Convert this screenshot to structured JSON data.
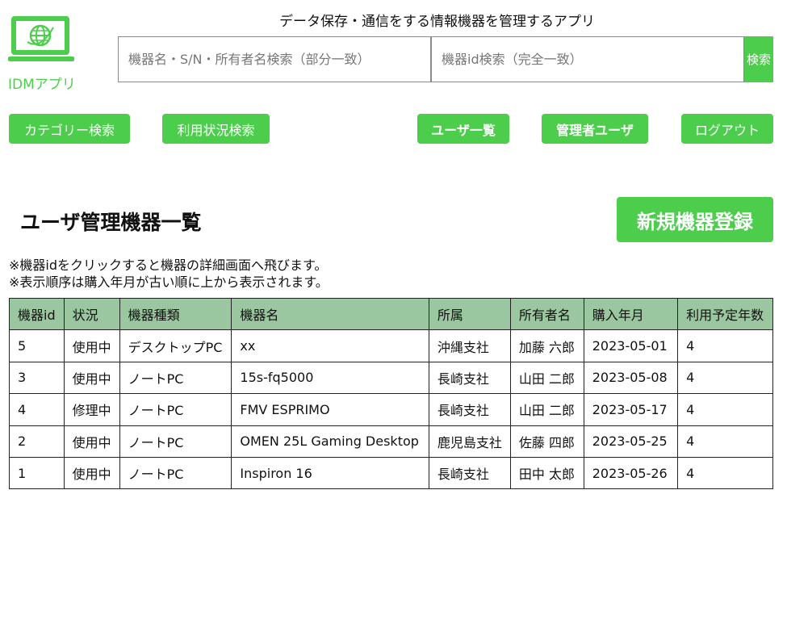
{
  "header": {
    "logo_text": "IDMアプリ",
    "subtitle": "データ保存・通信をする情報機器を管理するアプリ",
    "search": {
      "name_placeholder": "機器名・S/N・所有者名検索（部分一致）",
      "name_value": "",
      "id_placeholder": "機器id検索（完全一致）",
      "id_value": "",
      "button_label": "検索"
    },
    "colors": {
      "accent": "#4cce4c",
      "table_header": "#9ac79f"
    }
  },
  "nav": {
    "category_search": "カテゴリー検索",
    "usage_search": "利用状況検索",
    "user_list": "ユーザ一覧",
    "admin_user": "管理者ユーザ",
    "logout": "ログアウト"
  },
  "main": {
    "title": "ユーザ管理機器一覧",
    "register_button": "新規機器登録",
    "notes": [
      "※機器idをクリックすると機器の詳細画面へ飛びます。",
      "※表示順序は購入年月が古い順に上から表示されます。"
    ],
    "table": {
      "headers": [
        "機器id",
        "状況",
        "機器種類",
        "機器名",
        "所属",
        "所有者名",
        "購入年月",
        "利用予定年数"
      ],
      "rows": [
        [
          "5",
          "使用中",
          "デスクトップPC",
          "xx",
          "沖縄支社",
          "加藤 六郎",
          "2023-05-01",
          "4"
        ],
        [
          "3",
          "使用中",
          "ノートPC",
          "15s-fq5000",
          "長崎支社",
          "山田 二郎",
          "2023-05-08",
          "4"
        ],
        [
          "4",
          "修理中",
          "ノートPC",
          "FMV ESPRIMO",
          "長崎支社",
          "山田 二郎",
          "2023-05-17",
          "4"
        ],
        [
          "2",
          "使用中",
          "ノートPC",
          "OMEN 25L Gaming Desktop",
          "鹿児島支社",
          "佐藤 四郎",
          "2023-05-25",
          "4"
        ],
        [
          "1",
          "使用中",
          "ノートPC",
          "Inspiron 16",
          "長崎支社",
          "田中 太郎",
          "2023-05-26",
          "4"
        ]
      ]
    }
  }
}
